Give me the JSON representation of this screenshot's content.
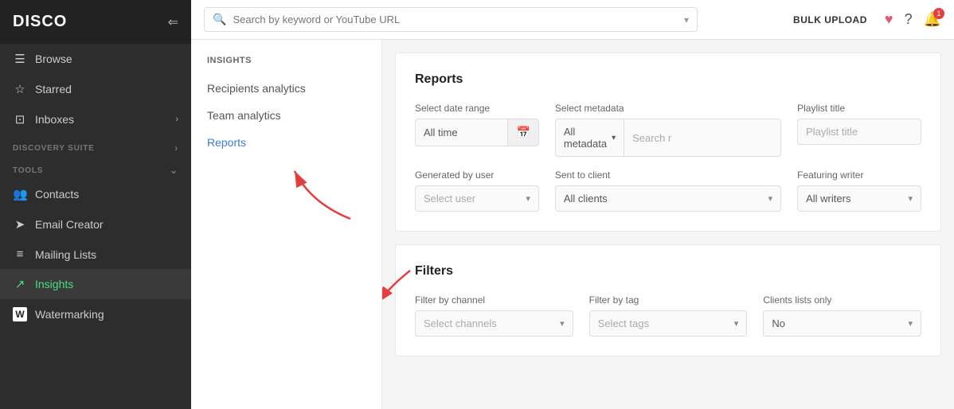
{
  "sidebar": {
    "logo": "DISCO",
    "nav_items": [
      {
        "id": "browse",
        "label": "Browse",
        "icon": "☰"
      },
      {
        "id": "starred",
        "label": "Starred",
        "icon": "☆"
      },
      {
        "id": "inboxes",
        "label": "Inboxes",
        "icon": "⊡",
        "has_arrow": true
      }
    ],
    "sections": [
      {
        "id": "discovery-suite",
        "label": "DISCOVERY SUITE",
        "has_arrow": true
      },
      {
        "id": "tools",
        "label": "TOOLS",
        "has_arrow": true,
        "items": [
          {
            "id": "contacts",
            "label": "Contacts",
            "icon": "👥"
          },
          {
            "id": "email-creator",
            "label": "Email Creator",
            "icon": "➤"
          },
          {
            "id": "mailing-lists",
            "label": "Mailing Lists",
            "icon": "≡"
          },
          {
            "id": "insights",
            "label": "Insights",
            "icon": "📈",
            "active": true
          },
          {
            "id": "watermarking",
            "label": "Watermarking",
            "icon": "W",
            "box": true
          }
        ]
      }
    ]
  },
  "topbar": {
    "search_placeholder": "Search by keyword or YouTube URL",
    "bulk_upload": "BULK UPLOAD"
  },
  "sub_sidebar": {
    "header": "INSIGHTS",
    "items": [
      {
        "id": "recipients",
        "label": "Recipients analytics"
      },
      {
        "id": "team",
        "label": "Team analytics"
      },
      {
        "id": "reports",
        "label": "Reports",
        "active": true
      }
    ]
  },
  "reports_section": {
    "title": "Reports",
    "date_range_label": "Select date range",
    "date_range_value": "All time",
    "metadata_label": "Select metadata",
    "metadata_value": "All metadata",
    "metadata_search_placeholder": "Search r",
    "playlist_label": "Playlist title",
    "playlist_placeholder": "Playlist title",
    "generated_by_label": "Generated by user",
    "generated_by_placeholder": "Select user",
    "sent_to_label": "Sent to client",
    "sent_to_value": "All clients",
    "featuring_label": "Featuring writer",
    "featuring_value": "All writers"
  },
  "filters_section": {
    "title": "Filters",
    "channel_label": "Filter by channel",
    "channel_placeholder": "Select channels",
    "tag_label": "Filter by tag",
    "tag_placeholder": "Select tags",
    "clients_label": "Clients lists only",
    "clients_value": "No"
  }
}
